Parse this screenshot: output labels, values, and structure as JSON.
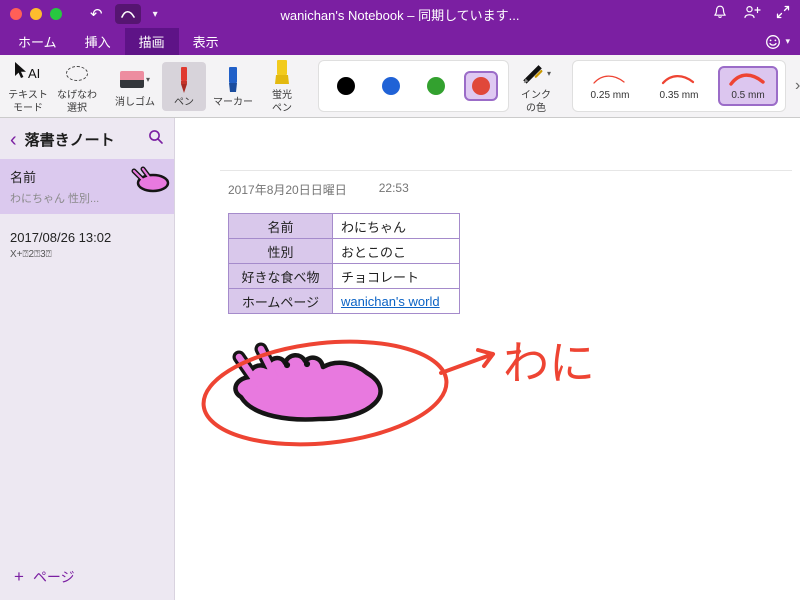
{
  "icons": {
    "chevron_down": "▾",
    "back_chevron": "‹",
    "undo": "↶",
    "overflow_right": "›",
    "plus": "+"
  },
  "colors": {
    "accent_purple": "#7B1FA2",
    "ink_red": "#EE4433",
    "doodle_pink": "#E879DF",
    "link_blue": "#0B63C5",
    "swatch_black": "#000000",
    "swatch_blue": "#2062D6",
    "swatch_green": "#33A12F",
    "swatch_red": "#E0483A"
  },
  "titlebar": {
    "title": "wanichan's Notebook – 同期しています..."
  },
  "tabs": {
    "items": [
      {
        "label": "ホーム"
      },
      {
        "label": "挿入"
      },
      {
        "label": "描画"
      },
      {
        "label": "表示"
      }
    ]
  },
  "ribbon": {
    "text_mode": {
      "line1": "テキスト",
      "line2": "モード",
      "icon_text": "AI"
    },
    "lasso": {
      "line1": "なげなわ",
      "line2": "選択"
    },
    "eraser": {
      "label": "消しゴム"
    },
    "pen": {
      "label": "ペン"
    },
    "marker": {
      "label": "マーカー"
    },
    "highlighter": {
      "line1": "蛍光",
      "line2": "ペン"
    },
    "ink_color": {
      "line1": "インク",
      "line2": "の色"
    },
    "widths": [
      {
        "label": "0.25 mm"
      },
      {
        "label": "0.35 mm"
      },
      {
        "label": "0.5 mm"
      }
    ]
  },
  "sidebar": {
    "notebook_title": "落書きノート",
    "pages": [
      {
        "title": "名前",
        "subtitle": "わにちゃん 性別..."
      },
      {
        "title": "2017/08/26 13:02",
        "subtitle": "X+⍰2⍰3⍰"
      }
    ],
    "add_page_label": "ページ"
  },
  "page": {
    "date": "2017年8月20日日曜日",
    "time": "22:53",
    "table": [
      {
        "header": "名前",
        "value": "わにちゃん"
      },
      {
        "header": "性別",
        "value": "おとこのこ"
      },
      {
        "header": "好きな食べ物",
        "value": "チョコレート"
      },
      {
        "header": "ホームページ",
        "value": "wanichan's world"
      }
    ],
    "annotation": "わに"
  }
}
